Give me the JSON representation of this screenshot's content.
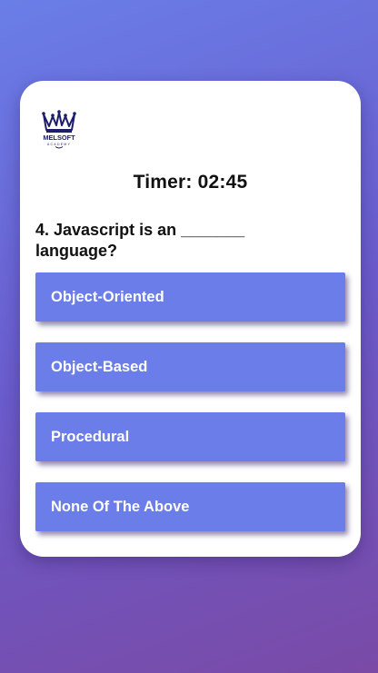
{
  "header": {
    "logo_icon": "crown-logo-icon",
    "logo_text": "MELSOFT",
    "logo_subtext": "ACADEMY"
  },
  "timer": {
    "text": "Timer: 02:45"
  },
  "quiz": {
    "question": "4. Javascript is an _______ language?",
    "options": [
      {
        "label": "Object-Oriented"
      },
      {
        "label": "Object-Based"
      },
      {
        "label": "Procedural"
      },
      {
        "label": "None Of The Above"
      }
    ]
  },
  "colors": {
    "option_bg": "#6b7de9",
    "background_start": "#6a7ee8",
    "background_end": "#7a4aa6",
    "logo": "#1c1d6b"
  }
}
